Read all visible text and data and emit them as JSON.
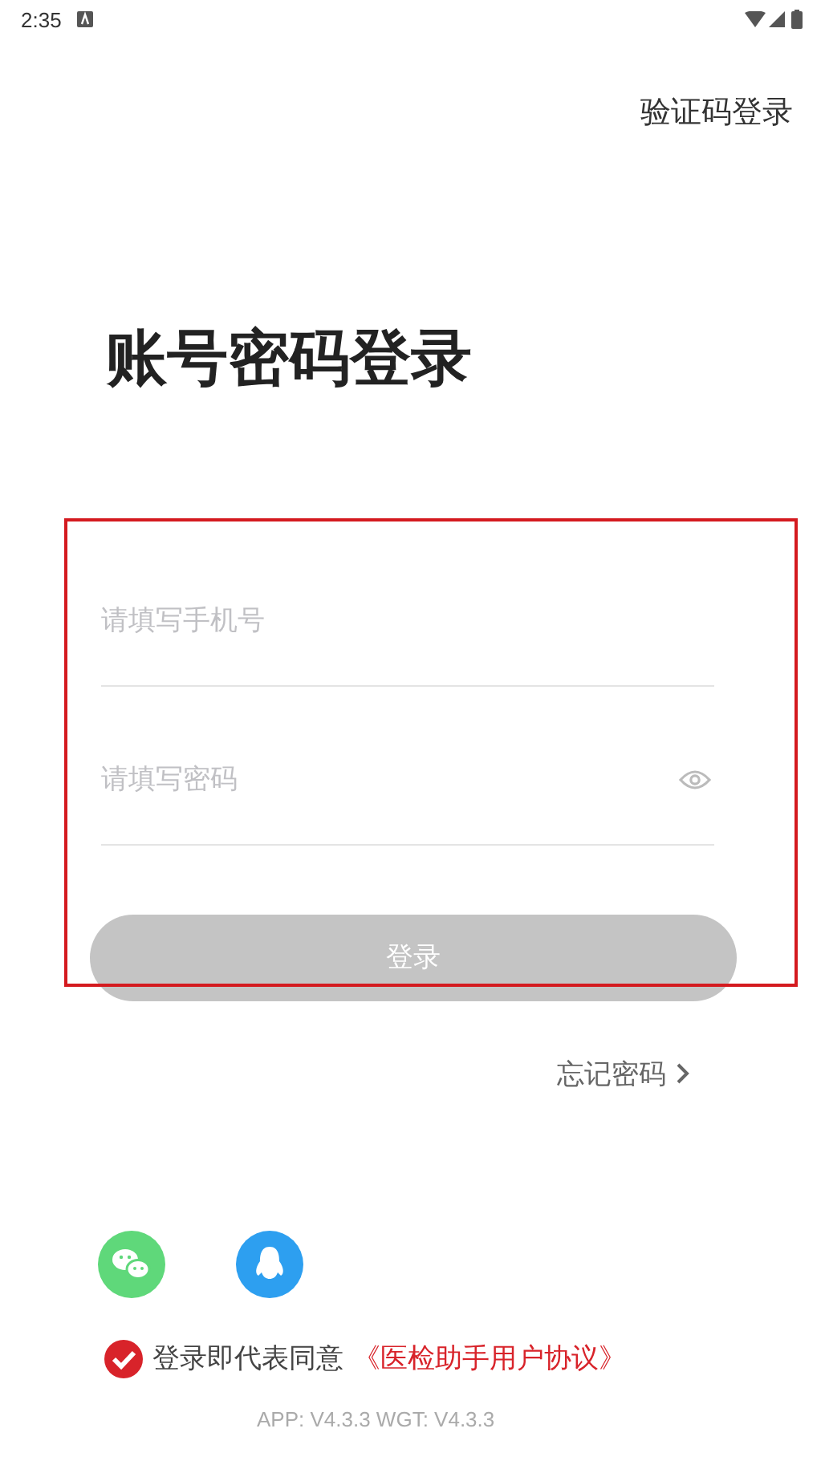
{
  "status_bar": {
    "time": "2:35"
  },
  "top_link": "验证码登录",
  "title": "账号密码登录",
  "fields": [
    {
      "kind": "phone",
      "placeholder": "请填写手机号"
    },
    {
      "kind": "password",
      "placeholder": "请填写密码"
    }
  ],
  "login_button": {
    "label": "登录",
    "disabled": true
  },
  "forgot_link": "忘记密码",
  "social": [
    {
      "kind": "wechat"
    },
    {
      "kind": "qq"
    }
  ],
  "agreement": {
    "checked": true,
    "text": "登录即代表同意",
    "link": "《医检助手用户协议》"
  },
  "version": "APP: V4.3.3 WGT: V4.3.3"
}
